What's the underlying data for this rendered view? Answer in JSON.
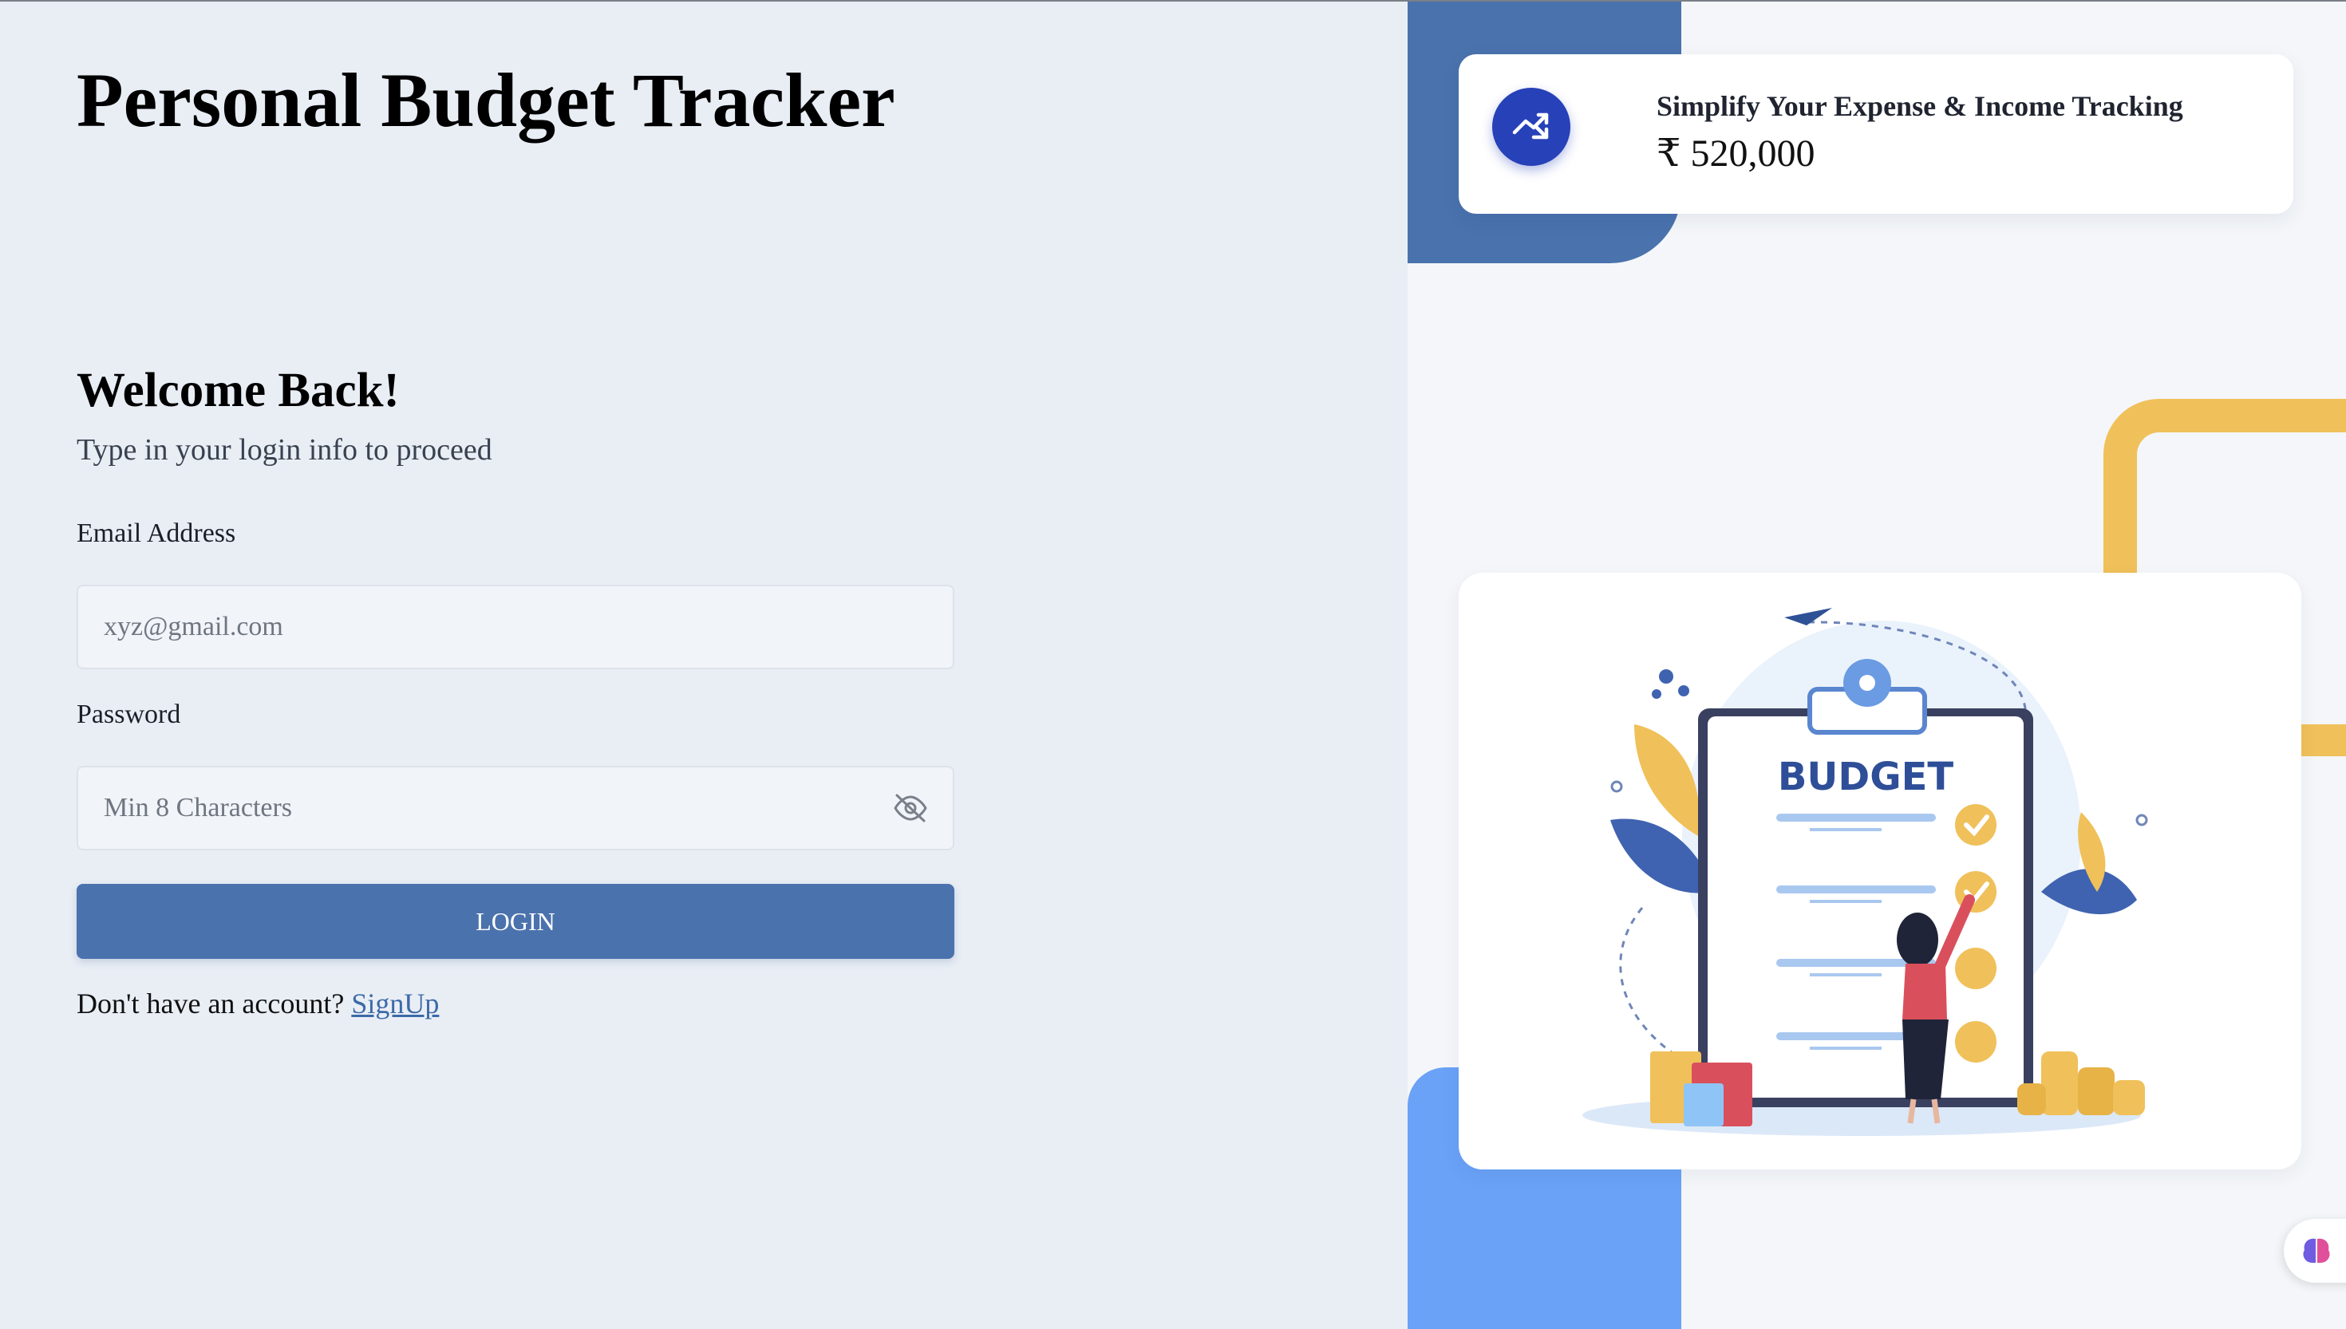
{
  "app": {
    "title": "Personal Budget Tracker"
  },
  "login": {
    "heading": "Welcome Back!",
    "subheading": "Type in your login info to proceed",
    "email_label": "Email Address",
    "email_placeholder": "xyz@gmail.com",
    "email_value": "",
    "password_label": "Password",
    "password_placeholder": "Min 8 Characters",
    "password_value": "",
    "login_button": "LOGIN",
    "signup_prompt": "Don't have an account?",
    "signup_link": "SignUp"
  },
  "stat_card": {
    "title": "Simplify Your Expense & Income Tracking",
    "value": "₹ 520,000",
    "icon": "trending-up-down-icon"
  },
  "illustration": {
    "clipboard_text": "BUDGET",
    "icon": "budget-clipboard-illustration"
  },
  "helper": {
    "icon": "brain-icon"
  },
  "colors": {
    "primary": "#4a72ad",
    "accent_blue": "#69a2f7",
    "stat_icon_bg": "#2741b8",
    "yellow": "#f0c05a",
    "left_bg": "#e9eef5",
    "right_bg": "#f4f6f9"
  }
}
